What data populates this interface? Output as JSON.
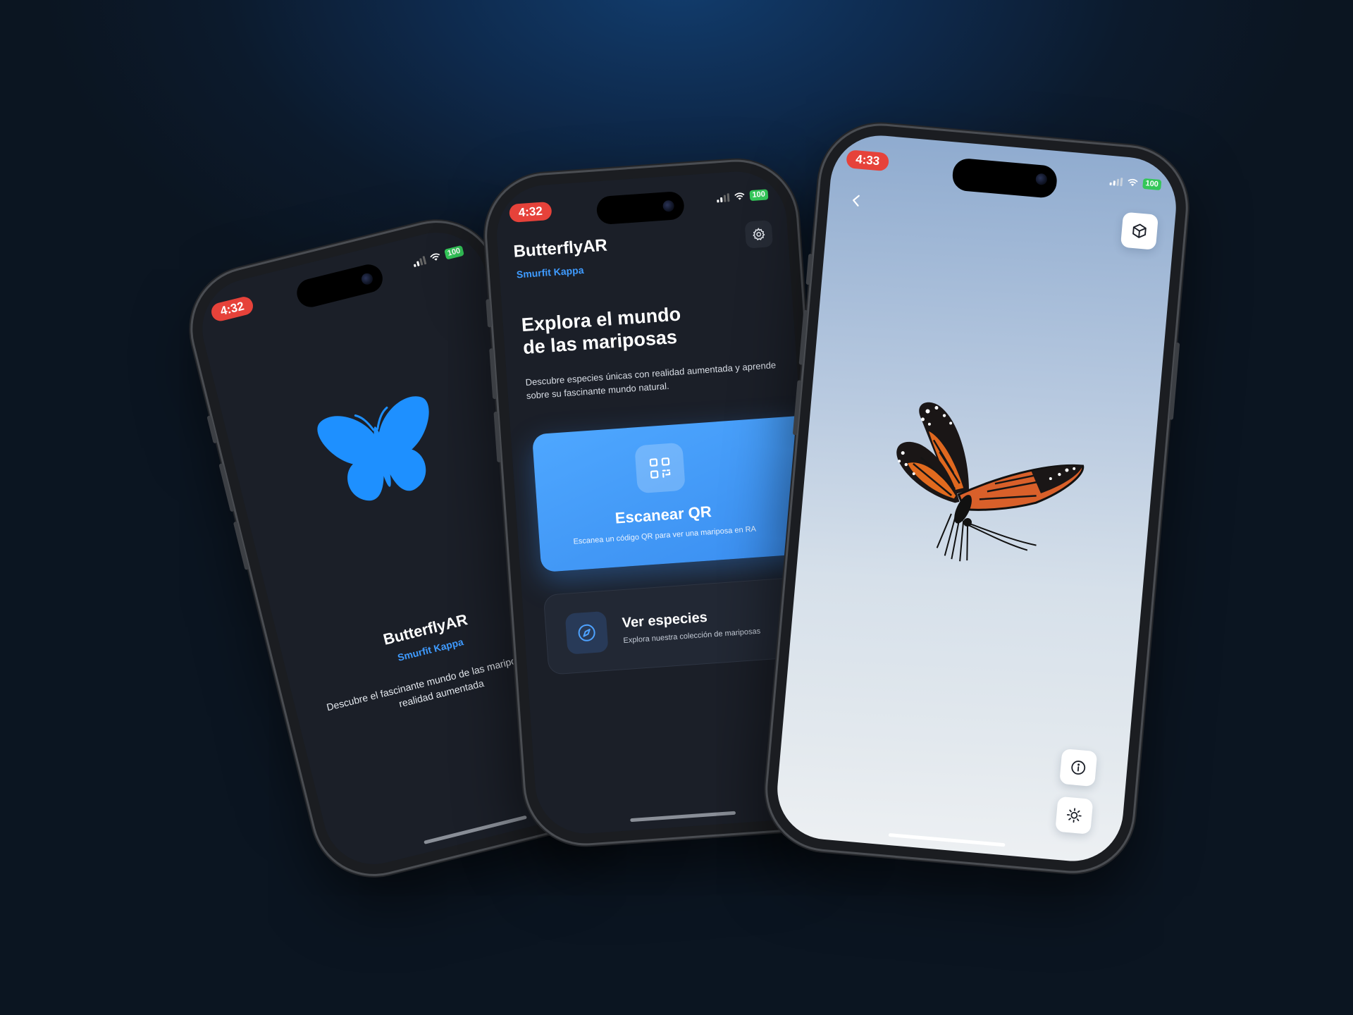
{
  "phone_left": {
    "status": {
      "time": "4:32",
      "battery": "100"
    },
    "app_name": "ButterflyAR",
    "company": "Smurfit Kappa",
    "description": "Descubre el fascinante mundo de las mariposas con realidad aumentada"
  },
  "phone_center": {
    "status": {
      "time": "4:32",
      "battery": "100"
    },
    "app_name": "ButterflyAR",
    "company": "Smurfit Kappa",
    "settings_icon": "gear-icon",
    "headline_line1": "Explora el mundo",
    "headline_line2": "de las mariposas",
    "subtitle": "Descubre especies únicas con realidad aumentada y aprende sobre su fascinante mundo natural.",
    "scan_card": {
      "icon": "qr-code-icon",
      "label": "Escanear QR",
      "description": "Escanea un código QR para ver una mariposa en RA"
    },
    "species_card": {
      "icon": "compass-icon",
      "label": "Ver especies",
      "description": "Explora nuestra colección de mariposas"
    }
  },
  "phone_right": {
    "status": {
      "time": "4:33",
      "battery": "100"
    },
    "back_icon": "chevron-left-icon",
    "model_icon": "cube-icon",
    "info_icon": "info-icon",
    "brightness_icon": "sun-icon"
  },
  "colors": {
    "accent": "#3f9bff",
    "time_pill": "#e6423a",
    "battery": "#34c759",
    "app_bg": "#1b1f28"
  }
}
